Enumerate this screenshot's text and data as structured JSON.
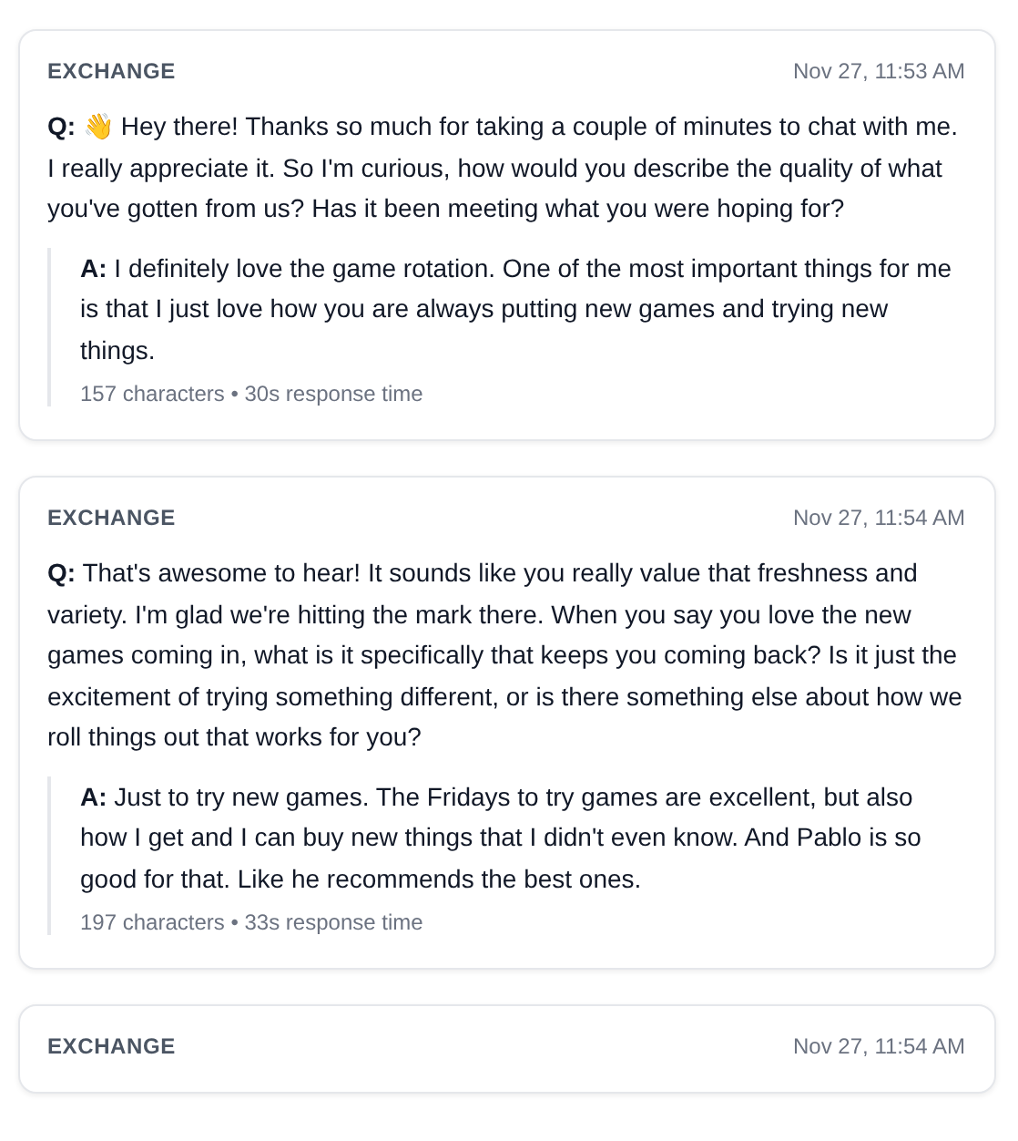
{
  "exchanges": [
    {
      "heading": "EXCHANGE",
      "time": "Nov 27, 11:53 AM",
      "question": "**Q:** 👋 Hey there! Thanks so much for taking a couple of minutes to chat with me. I really appreciate it. So I'm curious, how would you describe the quality of what you've gotten from us? Has it been meeting what you were hoping for?",
      "answer": {
        "text": "**A:** I definitely love the game rotation. One of the most important things for me is that I just love how you are always putting new games and trying new things.",
        "meta": "157 characters • 30s response time"
      }
    },
    {
      "heading": "EXCHANGE",
      "time": "Nov 27, 11:54 AM",
      "question": "**Q:** That's awesome to hear! It sounds like you really value that freshness and variety. I'm glad we're hitting the mark there. When you say you love the new games coming in, what is it specifically that keeps you coming back? Is it just the excitement of trying something different, or is there something else about how we roll things out that works for you?",
      "answer": {
        "text": "**A:** Just to try new games. The Fridays to try games are excellent, but also how I get and I can buy new things that I didn't even know. And Pablo is so good for that. Like he recommends the best ones.",
        "meta": "197 characters • 33s response time"
      }
    },
    {
      "heading": "EXCHANGE",
      "time": "Nov 27, 11:54 AM"
    }
  ]
}
